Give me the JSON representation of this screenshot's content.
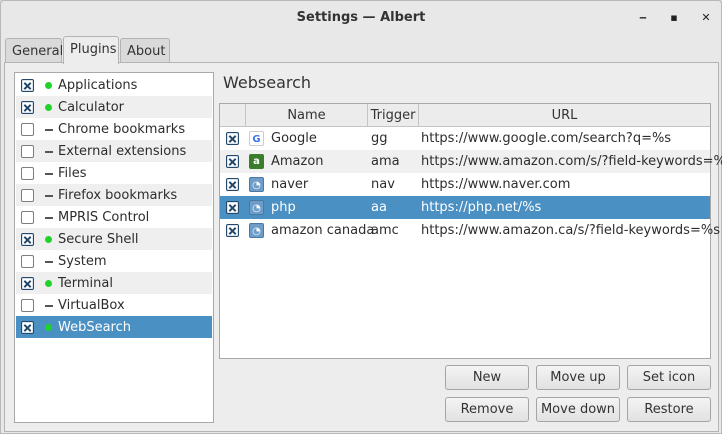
{
  "window": {
    "title": "Settings — Albert",
    "minimize": "‒",
    "maximize": "▪",
    "close": "✕"
  },
  "tabs": [
    {
      "label": "General"
    },
    {
      "label": "Plugins"
    },
    {
      "label": "About"
    }
  ],
  "plugins": [
    {
      "label": "Applications",
      "checked": true,
      "status": "active"
    },
    {
      "label": "Calculator",
      "checked": true,
      "status": "active"
    },
    {
      "label": "Chrome bookmarks",
      "checked": false,
      "status": "inactive"
    },
    {
      "label": "External extensions",
      "checked": false,
      "status": "inactive"
    },
    {
      "label": "Files",
      "checked": false,
      "status": "inactive"
    },
    {
      "label": "Firefox bookmarks",
      "checked": false,
      "status": "inactive"
    },
    {
      "label": "MPRIS Control",
      "checked": false,
      "status": "inactive"
    },
    {
      "label": "Secure Shell",
      "checked": true,
      "status": "active"
    },
    {
      "label": "System",
      "checked": false,
      "status": "inactive"
    },
    {
      "label": "Terminal",
      "checked": true,
      "status": "active"
    },
    {
      "label": "VirtualBox",
      "checked": false,
      "status": "inactive"
    },
    {
      "label": "WebSearch",
      "checked": true,
      "status": "active"
    }
  ],
  "websearch": {
    "title": "Websearch",
    "columns": {
      "name": "Name",
      "trigger": "Trigger",
      "url": "URL"
    },
    "rows": [
      {
        "name": "Google",
        "trigger": "gg",
        "url": "https://www.google.com/search?q=%s",
        "icon": "google-icon"
      },
      {
        "name": "Amazon",
        "trigger": "ama",
        "url": "https://www.amazon.com/s/?field-keywords=%s",
        "icon": "amazon-icon"
      },
      {
        "name": "naver",
        "trigger": "nav",
        "url": "https://www.naver.com",
        "icon": "web-icon"
      },
      {
        "name": "php",
        "trigger": "aa",
        "url": "https://php.net/%s",
        "icon": "web-icon"
      },
      {
        "name": "amazon canada",
        "trigger": "amc",
        "url": "https://www.amazon.ca/s/?field-keywords=%s",
        "icon": "web-icon"
      }
    ],
    "buttons": {
      "new": "New",
      "move_up": "Move up",
      "set_icon": "Set icon",
      "remove": "Remove",
      "move_down": "Move down",
      "restore": "Restore"
    }
  },
  "colors": {
    "selection": "#4a90c2",
    "status_active": "#1fd32a"
  }
}
